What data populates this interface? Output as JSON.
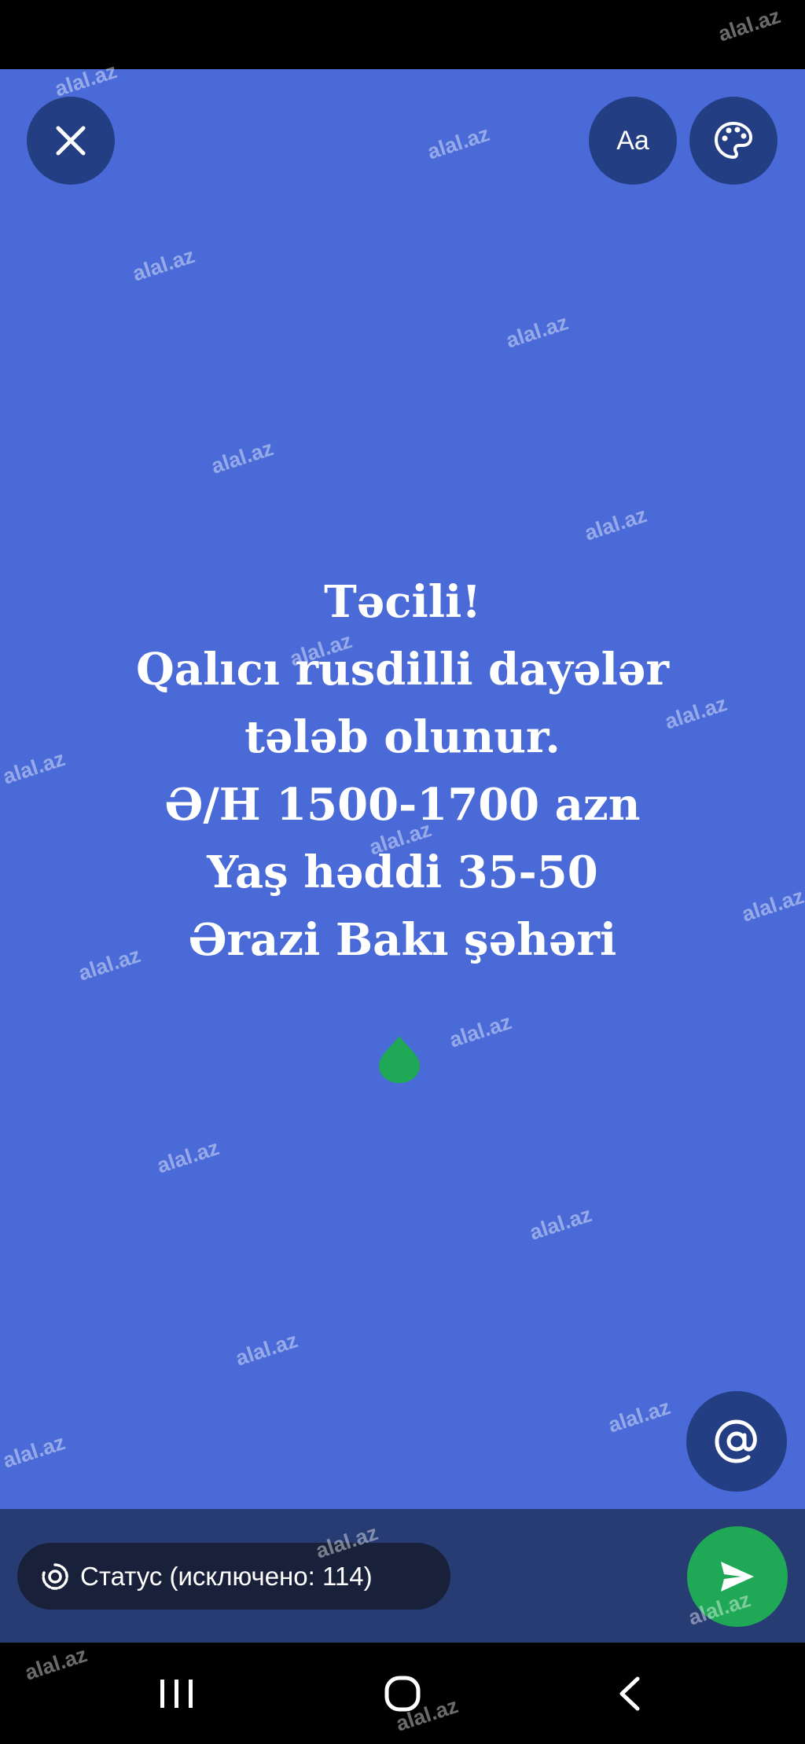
{
  "story": {
    "status_lines": [
      "Təcili!",
      "Qalıcı rusdilli dayələr",
      "tələb olunur.",
      "Ə/H 1500-1700 azn",
      "Yaş həddi 35-50",
      "Ərazi Bakı şəhəri"
    ],
    "background_color": "#4a6bd7",
    "accent_color": "#1fa855"
  },
  "toolbar": {
    "font_label": "Aa",
    "close_icon": "close-icon",
    "palette_icon": "palette-icon"
  },
  "composer": {
    "status_audience_label": "Статус (исключено: 114)",
    "mention_icon": "at-icon",
    "send_icon": "send-icon"
  },
  "watermark": "alal.az",
  "nav": {
    "recent_icon": "recent-apps-icon",
    "home_icon": "home-icon",
    "back_icon": "back-icon"
  }
}
